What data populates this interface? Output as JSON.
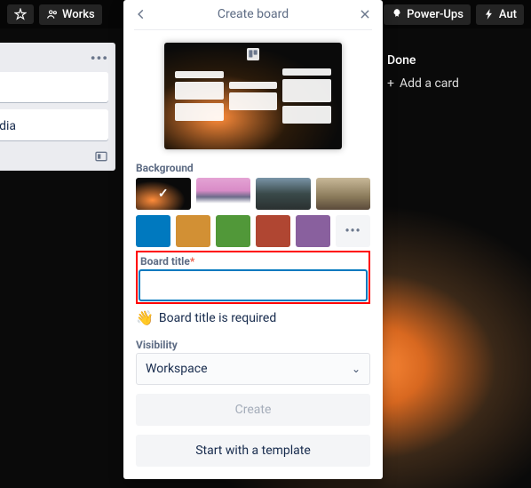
{
  "topbar": {
    "star_icon": "star-icon",
    "workspaces_label": "Works",
    "powerups_label": "Power-Ups",
    "automation_label": "Aut"
  },
  "left_list": {
    "card_text": "l fruit of india"
  },
  "done_list": {
    "title": "Done",
    "add_card": "Add a card"
  },
  "popover": {
    "title": "Create board",
    "background_label": "Background",
    "bg_options": {
      "more": "•••"
    },
    "board_title": {
      "label": "Board title",
      "required_mark": "*",
      "value": "",
      "hint": "Board title is required",
      "hint_emoji": "👋"
    },
    "visibility": {
      "label": "Visibility",
      "value": "Workspace"
    },
    "create_btn": "Create",
    "template_btn": "Start with a template"
  }
}
